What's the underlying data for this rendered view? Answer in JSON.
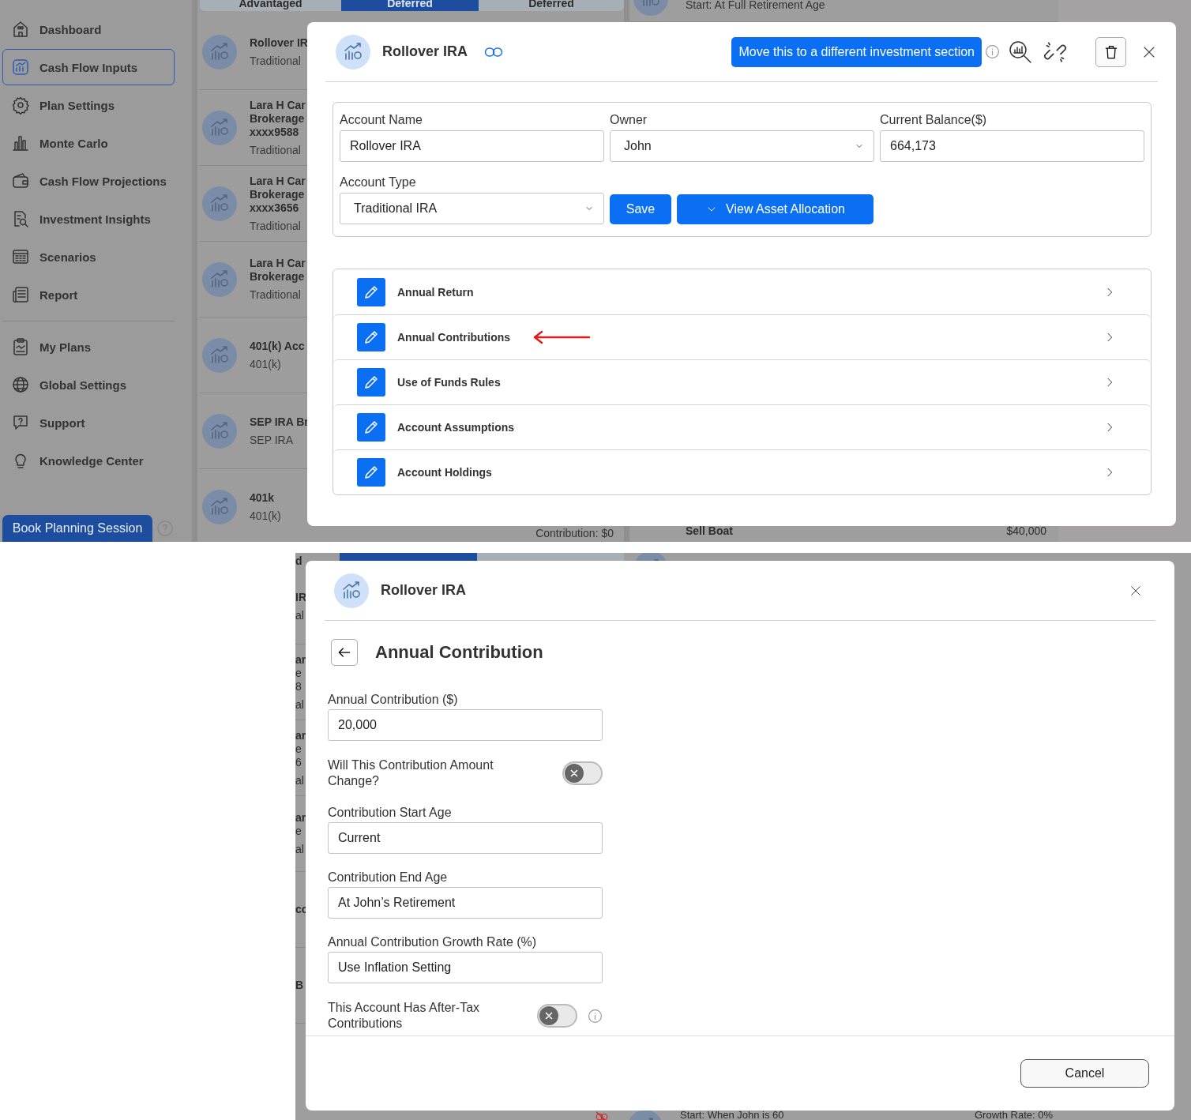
{
  "top_screen": {
    "sidebar": {
      "items": [
        {
          "label": "Dashboard",
          "selected": false
        },
        {
          "label": "Cash Flow Inputs",
          "selected": true
        },
        {
          "label": "Plan Settings",
          "selected": false
        },
        {
          "label": "Monte Carlo",
          "selected": false
        },
        {
          "label": "Cash Flow Projections",
          "selected": false
        },
        {
          "label": "Investment Insights",
          "selected": false
        },
        {
          "label": "Scenarios",
          "selected": false
        },
        {
          "label": "Report",
          "selected": false
        }
      ],
      "more_items": [
        {
          "label": "My Plans",
          "selected": false
        },
        {
          "label": "Global Settings",
          "selected": false
        },
        {
          "label": "Support",
          "selected": false
        },
        {
          "label": "Knowledge Center",
          "selected": false
        }
      ],
      "book_button": "Book Planning Session"
    },
    "tabs": [
      {
        "label": "Advantaged",
        "selected": false
      },
      {
        "label": "Deferred",
        "selected": true
      },
      {
        "label": "Deferred",
        "selected": false
      }
    ],
    "accounts": [
      {
        "name_lines": [
          "Rollover IR"
        ],
        "type": "Traditional"
      },
      {
        "name_lines": [
          "Lara H Car",
          "Brokerage",
          "xxxx9588"
        ],
        "type": "Traditional"
      },
      {
        "name_lines": [
          "Lara H Car",
          "Brokerage",
          "xxxx3656"
        ],
        "type": "Traditional"
      },
      {
        "name_lines": [
          "Lara H Car",
          "Brokerage"
        ],
        "type": "Traditional"
      },
      {
        "name_lines": [
          "401(k) Acc"
        ],
        "type": "401(k)"
      },
      {
        "name_lines": [
          "SEP IRA Br"
        ],
        "type": "SEP IRA"
      },
      {
        "name_lines": [
          "401k"
        ],
        "type": "401(k)",
        "detail": "Contribution: $0"
      }
    ],
    "events": {
      "top_text": "Start: At Full Retirement Age",
      "bottom_name": "Sell Boat",
      "bottom_amount": "$40,000"
    },
    "modal": {
      "title": "Rollover IRA",
      "move_button": "Move this to a different investment section",
      "fields": [
        {
          "kind": "input",
          "label": "Account Name",
          "value": "Rollover IRA"
        },
        {
          "kind": "select",
          "label": "Owner",
          "value": "John"
        },
        {
          "kind": "input",
          "label": "Current Balance($)",
          "value": "664,173"
        },
        {
          "kind": "select",
          "label": "Account Type",
          "value": "Traditional IRA"
        }
      ],
      "save_button": "Save",
      "allocation_button": "View Asset Allocation",
      "sections": [
        {
          "label": "Annual Return",
          "annotated": false
        },
        {
          "label": "Annual Contributions",
          "annotated": true
        },
        {
          "label": "Use of Funds Rules",
          "annotated": false
        },
        {
          "label": "Account Assumptions",
          "annotated": false
        },
        {
          "label": "Account Holdings",
          "annotated": false
        }
      ]
    }
  },
  "bottom_screen": {
    "tabs": [
      {
        "label": "d",
        "selected": false
      },
      {
        "selected": true
      },
      {
        "selected": false
      }
    ],
    "fragments": [
      [
        "IR",
        "al"
      ],
      [
        "ar",
        "e",
        "8",
        "al"
      ],
      [
        "ar",
        "e",
        "6",
        "al"
      ],
      [
        "ar",
        "e",
        "al"
      ],
      [
        "cc"
      ],
      [
        "B"
      ]
    ],
    "bottom_strip": {
      "start": "Start: When John is 60",
      "growth": "Growth Rate: 0%"
    },
    "modal": {
      "title": "Rollover IRA",
      "heading": "Annual Contribution",
      "fields": [
        {
          "kind": "input",
          "label": "Annual Contribution ($)",
          "value": "20,000"
        },
        {
          "kind": "toggle",
          "label": "Will This Contribution Amount Change?",
          "on": false,
          "info": false
        },
        {
          "kind": "input",
          "label": "Contribution Start Age",
          "value": "Current"
        },
        {
          "kind": "input",
          "label": "Contribution End Age",
          "value": "At John’s Retirement"
        },
        {
          "kind": "input",
          "label": "Annual Contribution Growth Rate (%)",
          "value": "Use Inflation Setting"
        },
        {
          "kind": "toggle",
          "label": "This Account Has After-Tax Contributions",
          "on": false,
          "info": true
        }
      ],
      "cancel_button": "Cancel"
    }
  }
}
